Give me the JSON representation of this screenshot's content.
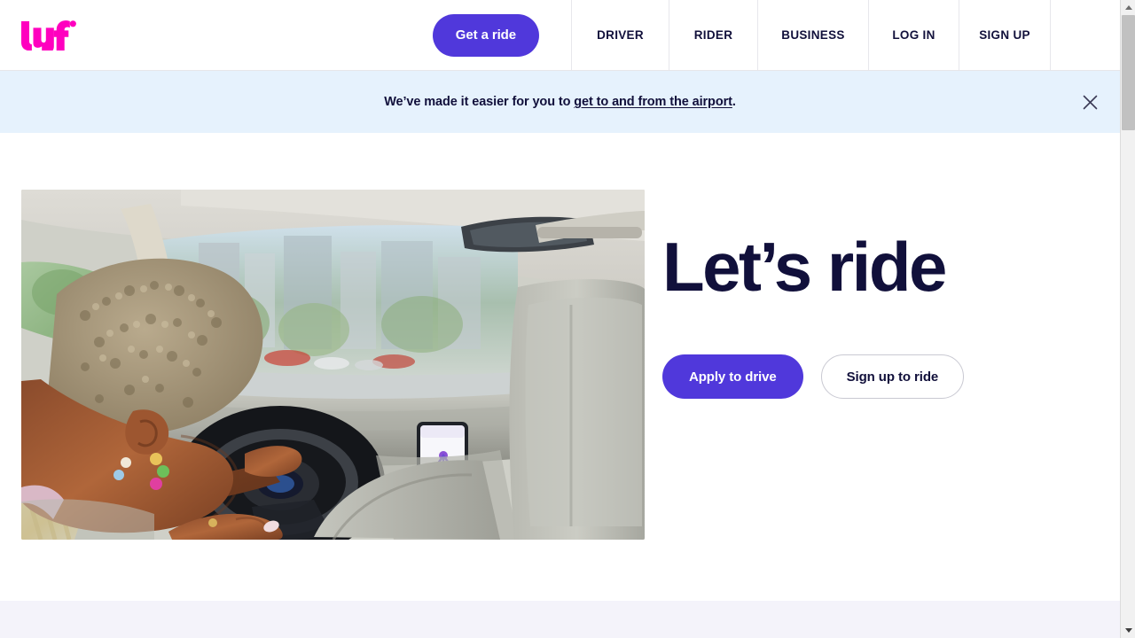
{
  "header": {
    "logo_alt": "Lyft",
    "logo_color": "#ff00bf",
    "cta_label": "Get a ride",
    "cta_color": "#5038db",
    "nav_items": [
      {
        "label": "DRIVER"
      },
      {
        "label": "RIDER"
      },
      {
        "label": "BUSINESS"
      },
      {
        "label": "LOG IN"
      },
      {
        "label": "SIGN UP"
      }
    ]
  },
  "banner": {
    "background_color": "#e6f2fd",
    "text_before": "We’ve made it easier for you to ",
    "link_text": "get to and from the airport",
    "text_after": ".",
    "close_icon": "close-icon"
  },
  "hero": {
    "title": "Let’s ride",
    "title_color": "#11103b",
    "primary_button": {
      "label": "Apply to drive",
      "color": "#5038db"
    },
    "secondary_button": {
      "label": "Sign up to ride",
      "color": "#ffffff"
    },
    "photo_alt": "Rider in the back seat of a car with a driver at the steering wheel"
  },
  "next_section": {
    "background_color": "#f4f3fa"
  },
  "scrollbar": {
    "up_arrow": "scroll-up-arrow",
    "down_arrow": "scroll-down-arrow",
    "thumb": "scroll-thumb"
  }
}
